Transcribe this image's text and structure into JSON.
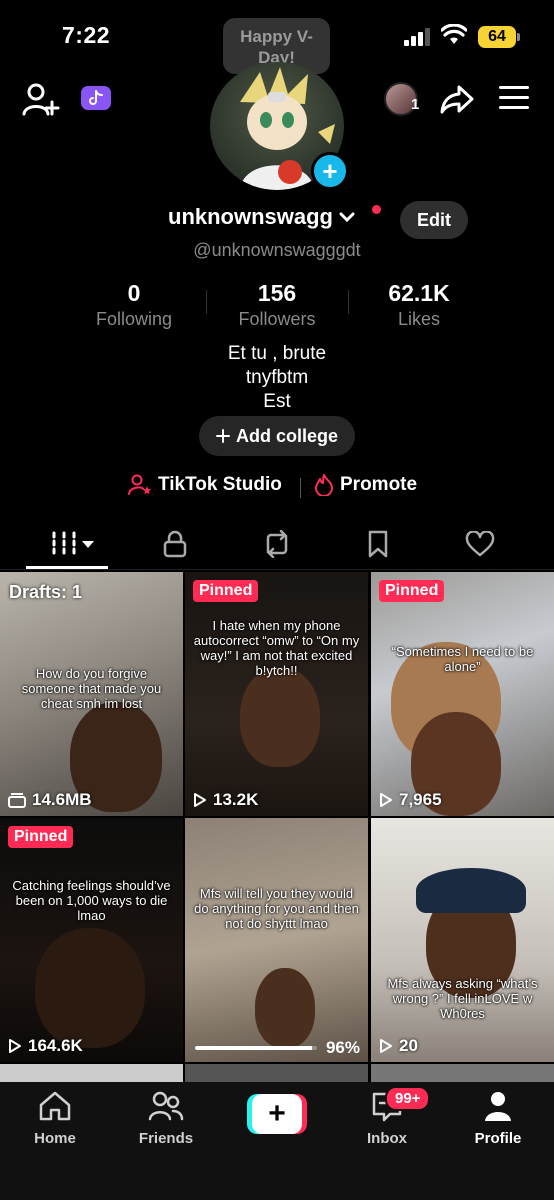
{
  "status_bar": {
    "time": "7:22",
    "battery": "64"
  },
  "header": {
    "note": "Happy V-Day!",
    "switch_count": "1"
  },
  "profile": {
    "username": "unknownswagg",
    "handle": "@unknownswagggdt",
    "edit_label": "Edit",
    "stats": [
      {
        "value": "0",
        "label": "Following"
      },
      {
        "value": "156",
        "label": "Followers"
      },
      {
        "value": "62.1K",
        "label": "Likes"
      }
    ],
    "bio": [
      "Et tu , brute",
      "tnyfbtm",
      "Est"
    ],
    "college_label": "Add college"
  },
  "tools": {
    "studio": "TikTok Studio",
    "promote": "Promote"
  },
  "tabs": [
    "videos",
    "private",
    "reposts",
    "favorites",
    "liked"
  ],
  "grid": [
    {
      "top_label": "Drafts: 1",
      "caption": "How do you forgive someone that made you cheat smh im lost",
      "stat": "14.6MB"
    },
    {
      "top_label": "Pinned",
      "caption": "I hate when my phone autocorrect “omw” to “On my way!” I am  not that excited b!ytch!!",
      "stat": "13.2K"
    },
    {
      "top_label": "Pinned",
      "caption": "“Sometimes I need to be alone”",
      "stat": "7,965"
    },
    {
      "top_label": "Pinned",
      "caption": "Catching feelings should’ve been on 1,000 ways to die lmao",
      "stat": "164.6K"
    },
    {
      "top_label": "",
      "caption": "Mfs will tell you they would do anything for you and then not do shyttt lmao",
      "stat": "96%",
      "upload_progress": 0.96
    },
    {
      "top_label": "",
      "caption": "Mfs always asking “what’s wrong ?” I fell inLOVE w Wh0res",
      "stat": "20"
    }
  ],
  "bottom_nav": {
    "home": "Home",
    "friends": "Friends",
    "inbox": "Inbox",
    "inbox_badge": "99+",
    "profile": "Profile"
  },
  "colors": {
    "accent": "#fe2c55",
    "cyan": "#25f4ee",
    "battery": "#f7d433",
    "plus_badge": "#19b8ea"
  }
}
